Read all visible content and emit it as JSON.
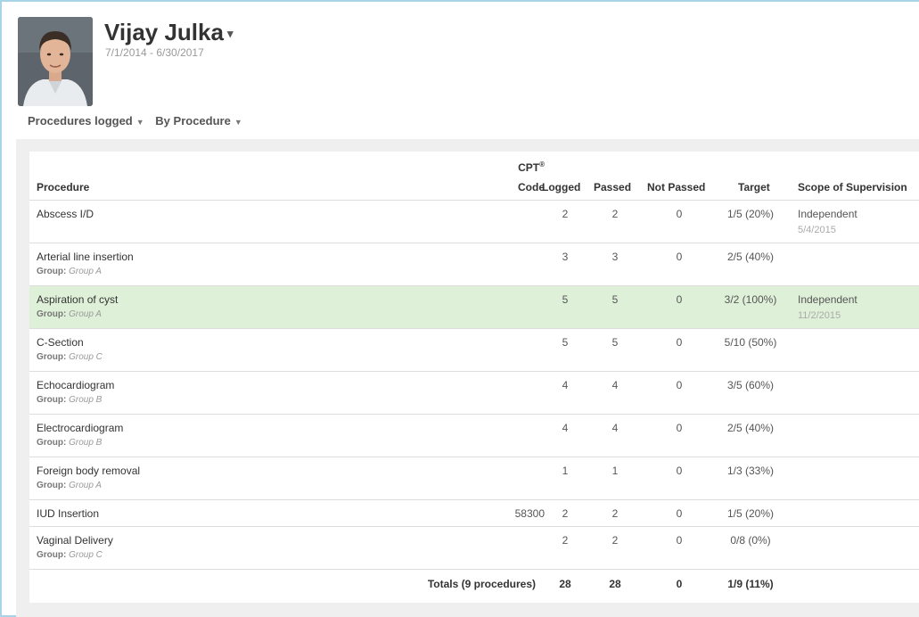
{
  "profile": {
    "name": "Vijay Julka",
    "date_range": "7/1/2014 - 6/30/2017"
  },
  "filters": [
    {
      "label": "Procedures logged"
    },
    {
      "label": "By Procedure"
    }
  ],
  "columns": {
    "procedure": "Procedure",
    "cpt_line1": "CPT",
    "cpt_mark": "®",
    "cpt_line2": "Code",
    "logged": "Logged",
    "passed": "Passed",
    "not_passed": "Not Passed",
    "target": "Target",
    "scope": "Scope of Supervision"
  },
  "group_prefix": "Group:",
  "rows": [
    {
      "procedure": "Abscess I/D",
      "group": "",
      "cpt": "",
      "logged": "2",
      "passed": "2",
      "not_passed": "0",
      "target": "1/5 (20%)",
      "scope": "Independent",
      "scope_date": "5/4/2015",
      "highlighted": false
    },
    {
      "procedure": "Arterial line insertion",
      "group": "Group A",
      "cpt": "",
      "logged": "3",
      "passed": "3",
      "not_passed": "0",
      "target": "2/5 (40%)",
      "scope": "",
      "scope_date": "",
      "highlighted": false
    },
    {
      "procedure": "Aspiration of cyst",
      "group": "Group A",
      "cpt": "",
      "logged": "5",
      "passed": "5",
      "not_passed": "0",
      "target": "3/2 (100%)",
      "scope": "Independent",
      "scope_date": "11/2/2015",
      "highlighted": true
    },
    {
      "procedure": "C-Section",
      "group": "Group C",
      "cpt": "",
      "logged": "5",
      "passed": "5",
      "not_passed": "0",
      "target": "5/10 (50%)",
      "scope": "",
      "scope_date": "",
      "highlighted": false
    },
    {
      "procedure": "Echocardiogram",
      "group": "Group B",
      "cpt": "",
      "logged": "4",
      "passed": "4",
      "not_passed": "0",
      "target": "3/5 (60%)",
      "scope": "",
      "scope_date": "",
      "highlighted": false
    },
    {
      "procedure": "Electrocardiogram",
      "group": "Group B",
      "cpt": "",
      "logged": "4",
      "passed": "4",
      "not_passed": "0",
      "target": "2/5 (40%)",
      "scope": "",
      "scope_date": "",
      "highlighted": false
    },
    {
      "procedure": "Foreign body removal",
      "group": "Group A",
      "cpt": "",
      "logged": "1",
      "passed": "1",
      "not_passed": "0",
      "target": "1/3 (33%)",
      "scope": "",
      "scope_date": "",
      "highlighted": false
    },
    {
      "procedure": "IUD Insertion",
      "group": "",
      "cpt": "58300",
      "logged": "2",
      "passed": "2",
      "not_passed": "0",
      "target": "1/5 (20%)",
      "scope": "",
      "scope_date": "",
      "highlighted": false
    },
    {
      "procedure": "Vaginal Delivery",
      "group": "Group C",
      "cpt": "",
      "logged": "2",
      "passed": "2",
      "not_passed": "0",
      "target": "0/8 (0%)",
      "scope": "",
      "scope_date": "",
      "highlighted": false
    }
  ],
  "totals": {
    "label": "Totals (9 procedures)",
    "logged": "28",
    "passed": "28",
    "not_passed": "0",
    "target": "1/9 (11%)"
  },
  "colors": {
    "highlight_row": "#dff0d8",
    "panel_bg": "#efefef",
    "frame_border": "#a9d3e6"
  }
}
